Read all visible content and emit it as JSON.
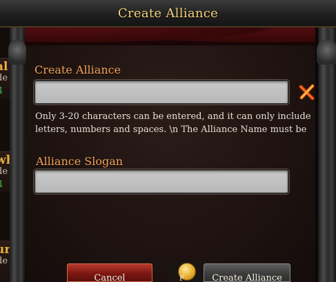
{
  "dialog": {
    "title": "Create Alliance"
  },
  "form": {
    "name_label": "Create Alliance",
    "name_value": "",
    "hint": "Only 3-20 characters can be entered, and it can only include letters, numbers and spaces. \\n The Alliance Name must be",
    "slogan_label": "Alliance Slogan",
    "slogan_value": ""
  },
  "buttons": {
    "cancel": "Cancel",
    "create": "Create Alliance"
  },
  "cost": {
    "icon": "gold-coin-icon",
    "amount": "F"
  },
  "background_list": [
    {
      "name": "al",
      "sub": "de",
      "num": "4"
    },
    {
      "name": "wh",
      "sub": "de",
      "num": "4"
    },
    {
      "name": "ur",
      "sub": "de",
      "num": ""
    }
  ],
  "colors": {
    "label": "#f2a35c",
    "title": "#f4d27a",
    "cancel": "#8a1c15",
    "create": "#4a4a4a"
  }
}
